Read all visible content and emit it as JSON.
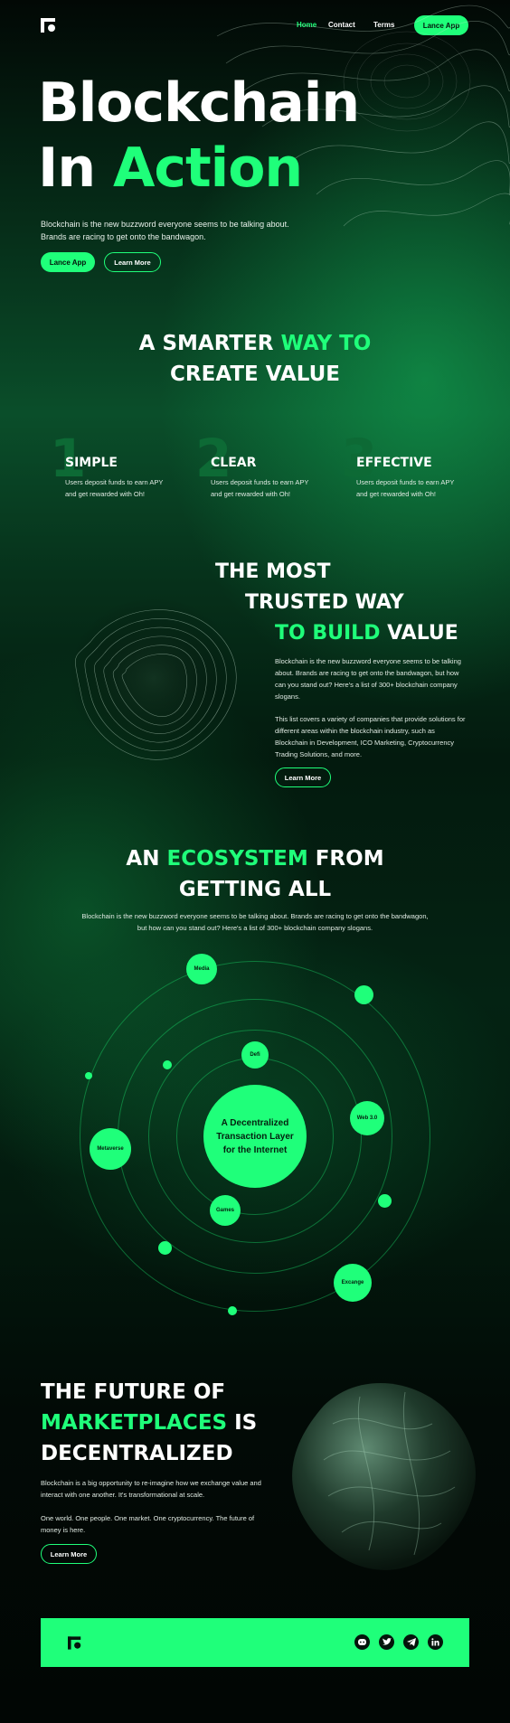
{
  "nav": {
    "links": [
      {
        "label": "Home",
        "active": true
      },
      {
        "label": "Contact",
        "active": false
      },
      {
        "label": "Terms",
        "active": false
      }
    ],
    "cta_label": "Lance App"
  },
  "hero": {
    "title_line1": "Blockchain",
    "title_line2_plain": "In",
    "title_line2_accent": "Action",
    "text": "Blockchain is the new buzzword everyone seems to be talking about. Brands are racing to get onto the bandwagon.",
    "primary_label": "Lance App",
    "secondary_label": "Learn More"
  },
  "smarter": {
    "line1_plain": "A SMARTER",
    "line1_accent": "WAY TO",
    "line2": "CREATE VALUE"
  },
  "features": [
    {
      "number": "1",
      "title": "SIMPLE",
      "text": "Users deposit funds to earn APY and get rewarded with Oh!"
    },
    {
      "number": "2",
      "title": "CLEAR",
      "text": "Users deposit funds to earn APY and get rewarded with Oh!"
    },
    {
      "number": "3",
      "title": "EFFECTIVE",
      "text": "Users deposit funds to earn APY and get rewarded with Oh!"
    }
  ],
  "trusted": {
    "line1": "THE MOST",
    "line2": "TRUSTED WAY",
    "line3_accent": "TO BUILD",
    "line3_plain": "VALUE",
    "para1": "Blockchain is the new buzzword everyone seems to be talking about. Brands are racing to get onto the bandwagon, but how can you stand out? Here's a list of 300+ blockchain company slogans.",
    "para2": "This list covers a variety of companies that provide solutions for different areas within the blockchain industry, such as Blockchain in Development, ICO Marketing, Cryptocurrency Trading Solutions, and more.",
    "button_label": "Learn More"
  },
  "ecosystem": {
    "line1_plain_a": "AN",
    "line1_accent": "ECOSYSTEM",
    "line1_plain_b": "FROM",
    "line2": "GETTING ALL",
    "text_line1": "Blockchain is the new buzzword everyone seems to be talking about. Brands are racing to get onto the bandwagon,",
    "text_line2": "but how can you stand out? Here's a list of 300+ blockchain company slogans.",
    "center_label": "A Decentralized Transaction Layer for the Internet",
    "nodes": {
      "media": "Media",
      "defi": "Defi",
      "web3": "Web 3.0",
      "metaverse": "Metaverse",
      "games": "Games",
      "exchange": "Excange"
    }
  },
  "future": {
    "line1": "THE FUTURE OF",
    "line2_accent": "MARKETPLACES",
    "line2_plain": "IS",
    "line3": "DECENTRALIZED",
    "para1": "Blockchain is a big opportunity to re-imagine how we exchange value and interact with one another. It's transformational at scale.",
    "para2": "One world. One people. One market. One cryptocurrency. The future of money is here.",
    "button_label": "Learn More"
  },
  "footer": {
    "socials": [
      "discord-icon",
      "twitter-icon",
      "telegram-icon",
      "linkedin-icon"
    ]
  },
  "colors": {
    "accent": "#1fff7a",
    "background": "#031a0e"
  }
}
